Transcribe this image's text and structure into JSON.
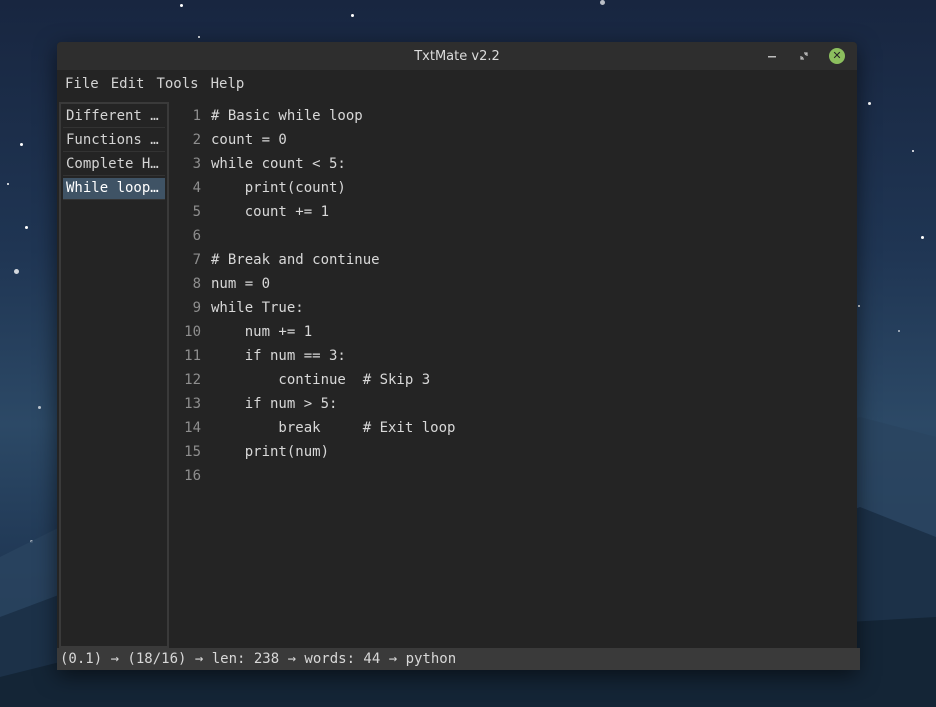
{
  "window": {
    "title": "TxtMate v2.2"
  },
  "menu": [
    "File",
    "Edit",
    "Tools",
    "Help"
  ],
  "sidebar": {
    "items": [
      {
        "label": "Different …",
        "active": false
      },
      {
        "label": "Functions …",
        "active": false
      },
      {
        "label": "Complete H…",
        "active": false
      },
      {
        "label": "While loop…",
        "active": true
      }
    ]
  },
  "editor": {
    "language": "python",
    "lines": [
      {
        "n": "1",
        "text": "# Basic while loop"
      },
      {
        "n": "2",
        "text": "count = 0"
      },
      {
        "n": "3",
        "text": "while count < 5:"
      },
      {
        "n": "4",
        "text": "    print(count)"
      },
      {
        "n": "5",
        "text": "    count += 1"
      },
      {
        "n": "6",
        "text": ""
      },
      {
        "n": "7",
        "text": "# Break and continue"
      },
      {
        "n": "8",
        "text": "num = 0"
      },
      {
        "n": "9",
        "text": "while True:"
      },
      {
        "n": "10",
        "text": "    num += 1"
      },
      {
        "n": "11",
        "text": "    if num == 3:"
      },
      {
        "n": "12",
        "text": "        continue  # Skip 3"
      },
      {
        "n": "13",
        "text": "    if num > 5:"
      },
      {
        "n": "14",
        "text": "        break     # Exit loop"
      },
      {
        "n": "15",
        "text": "    print(num)"
      },
      {
        "n": "16",
        "text": ""
      }
    ]
  },
  "status": {
    "text": "(0.1) → (18/16) → len: 238 → words: 44 → python"
  },
  "colors": {
    "accent_close": "#8cbf5e",
    "active_item": "#3f5365",
    "editor_bg": "#242424"
  },
  "icons": {
    "minimize": "minimize-icon",
    "restore": "restore-icon",
    "close": "close-icon"
  }
}
